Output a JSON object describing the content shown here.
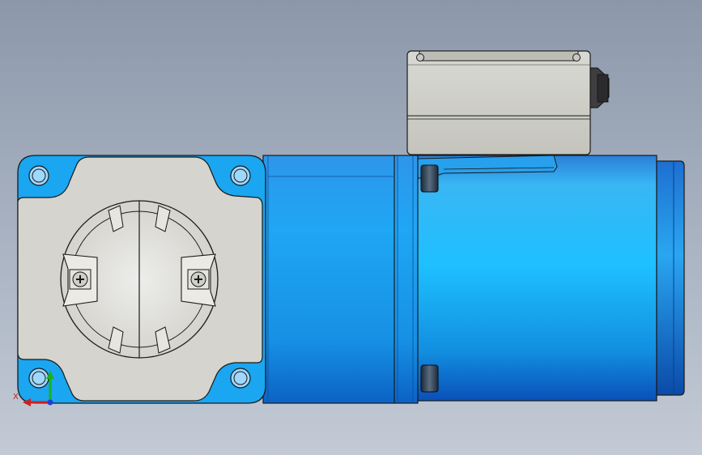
{
  "triad": {
    "x_label": "X"
  },
  "colors": {
    "background_top": "#8c98aa",
    "background_bottom": "#c3cad5",
    "motor_blue": "#1aa6f0",
    "flange_gray": "#d6d5cf",
    "terminal_box_gray": "#cfcfc8",
    "outline": "#1a1a1a"
  }
}
